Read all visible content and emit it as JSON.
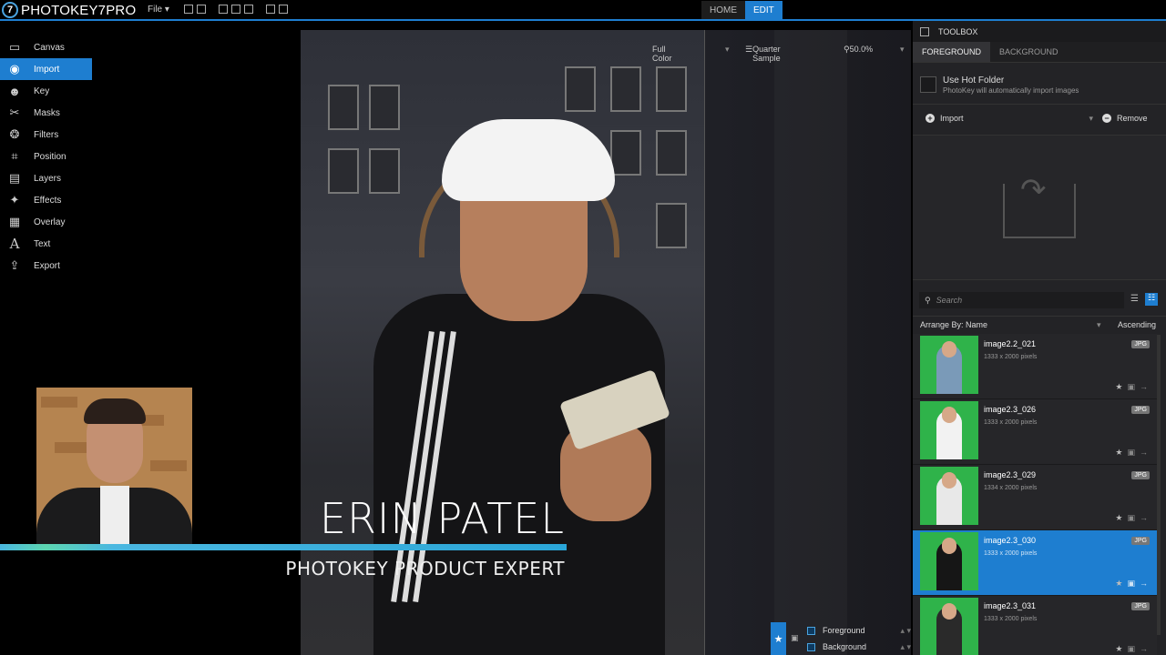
{
  "app": {
    "logo_glyph": "7",
    "name": "PHOTOKEY7PRO",
    "file_menu": "File",
    "tabs": [
      {
        "label": "HOME",
        "active": false
      },
      {
        "label": "EDIT",
        "active": true
      }
    ],
    "accent_color": "#1e7ed0"
  },
  "left_menu": {
    "items": [
      {
        "label": "Canvas",
        "icon": "canvas-icon",
        "active": false
      },
      {
        "label": "Import",
        "icon": "camera-icon",
        "active": true
      },
      {
        "label": "Key",
        "icon": "key-person-icon",
        "active": false
      },
      {
        "label": "Masks",
        "icon": "scissors-icon",
        "active": false
      },
      {
        "label": "Filters",
        "icon": "filters-icon",
        "active": false
      },
      {
        "label": "Position",
        "icon": "crop-icon",
        "active": false
      },
      {
        "label": "Layers",
        "icon": "layers-icon",
        "active": false
      },
      {
        "label": "Effects",
        "icon": "magic-wand-icon",
        "active": false
      },
      {
        "label": "Overlay",
        "icon": "grid-icon",
        "active": false
      },
      {
        "label": "Text",
        "icon": "text-icon",
        "active": false
      },
      {
        "label": "Export",
        "icon": "export-icon",
        "active": false
      }
    ]
  },
  "view_options": {
    "color_mode": "Full Color",
    "sample_mode": "Quarter Sample",
    "zoom": "50.0%"
  },
  "overlay": {
    "name": "ERIN PATEL",
    "title": "PHOTOKEY PRODUCT EXPERT"
  },
  "layer_controls": {
    "foreground": "Foreground",
    "background": "Background"
  },
  "toolbox": {
    "title": "TOOLBOX",
    "tabs": [
      {
        "label": "FOREGROUND",
        "active": true
      },
      {
        "label": "BACKGROUND",
        "active": false
      }
    ],
    "hot_folder_label": "Use Hot Folder",
    "hot_folder_desc": "PhotoKey will automatically import images",
    "import_label": "Import",
    "remove_label": "Remove",
    "search_placeholder": "Search",
    "arrange_label": "Arrange By: Name",
    "arrange_order": "Ascending",
    "files": [
      {
        "name": "image2.2_021",
        "size": "1333 x 2000 pixels",
        "type": "JPG",
        "selected": false,
        "outfit": "#7a9ab8"
      },
      {
        "name": "image2.3_026",
        "size": "1333 x 2000 pixels",
        "type": "JPG",
        "selected": false,
        "outfit": "#f2f2f2"
      },
      {
        "name": "image2.3_029",
        "size": "1334 x 2000 pixels",
        "type": "JPG",
        "selected": false,
        "outfit": "#e8e8e8"
      },
      {
        "name": "image2.3_030",
        "size": "1333 x 2000 pixels",
        "type": "JPG",
        "selected": true,
        "outfit": "#161616"
      },
      {
        "name": "image2.3_031",
        "size": "1333 x 2000 pixels",
        "type": "JPG",
        "selected": false,
        "outfit": "#2a2a2a"
      }
    ]
  }
}
